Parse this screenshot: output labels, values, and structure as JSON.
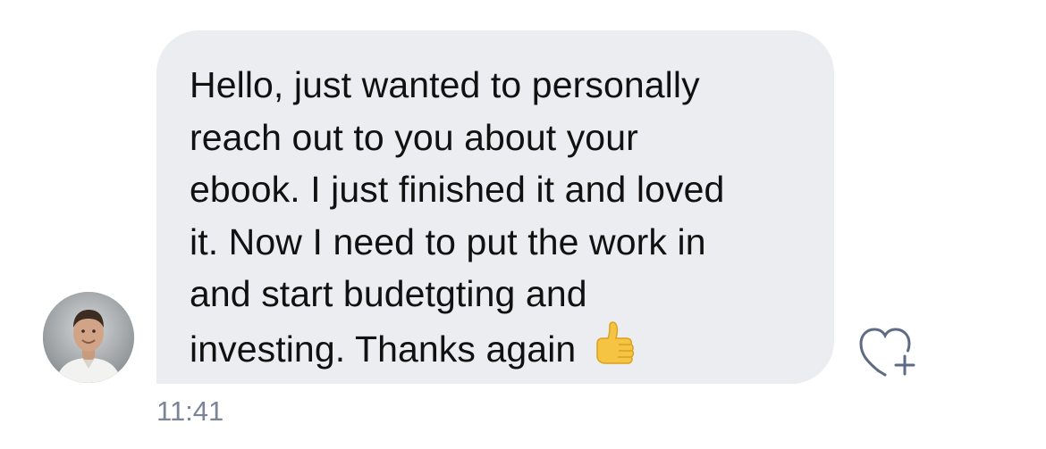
{
  "message": {
    "lines": [
      "Hello, just wanted to personally",
      "reach out to you about your",
      "ebook. I just finished it and loved",
      "it. Now I need to put the work in",
      "and start budetgting and",
      "investing. Thanks again"
    ],
    "emoji": "thumbs-up-emoji",
    "timestamp": "11:41"
  },
  "icons": {
    "avatar": "sender-avatar",
    "react": "heart-plus-icon"
  },
  "colors": {
    "bubble": "#ecedf0",
    "text": "#111111",
    "timestamp": "#7a8597",
    "icon": "#5d6b85"
  }
}
